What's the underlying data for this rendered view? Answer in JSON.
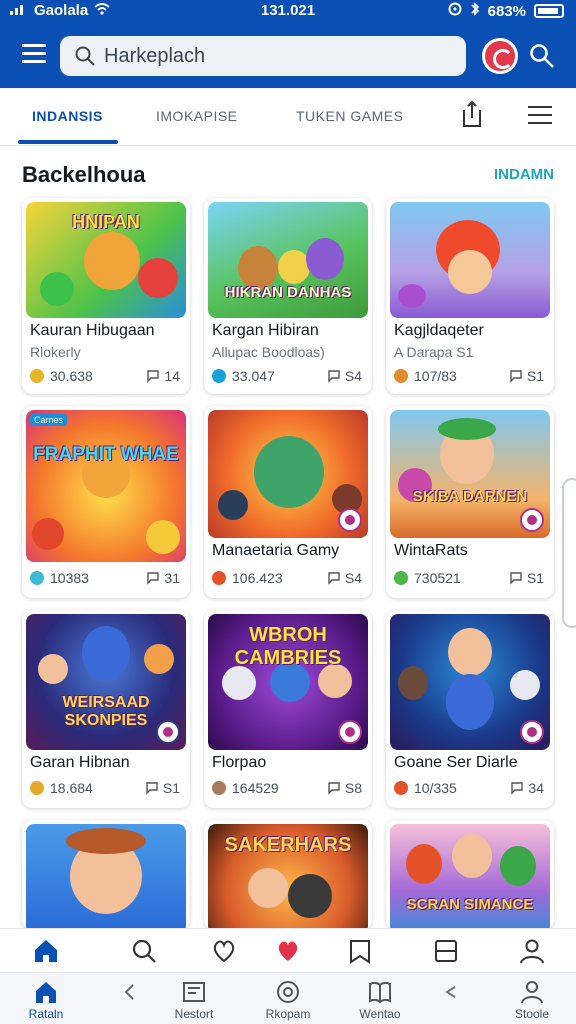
{
  "status_bar": {
    "carrier": "Gaolala",
    "time": "131.021",
    "battery": "683%"
  },
  "search": {
    "placeholder": "Harkeplach"
  },
  "tabs": [
    {
      "label": "INDANSIS",
      "active": true
    },
    {
      "label": "IMOKAPISE",
      "active": false
    },
    {
      "label": "TUKEN GAMES",
      "active": false
    }
  ],
  "section": {
    "title": "Backelhoua",
    "link": "INDAMN"
  },
  "cards": [
    {
      "art": "HNIPAN",
      "name": "Kauran Hibugaan",
      "sub": "Rlokerly",
      "count": "30.638",
      "comments": "14"
    },
    {
      "art": "HIKRAN DANHAS",
      "name": "Kargan Hibiran",
      "sub": "Allupac Boodloas)",
      "count": "33.047",
      "comments": "S4"
    },
    {
      "art": "",
      "name": "Kagjldaqeter",
      "sub": "A Darapa S1",
      "count": "107/83",
      "comments": "S1"
    },
    {
      "art": "FRAPHIT WHAE",
      "name": "",
      "sub": "",
      "count": "10383",
      "comments": "31",
      "tag": "Carnes"
    },
    {
      "art": "",
      "name": "Manaetaria Gamy",
      "sub": "",
      "count": "106.423",
      "comments": "S4"
    },
    {
      "art": "SKIBA DARNEN",
      "name": "WintaRats",
      "sub": "",
      "count": "730521",
      "comments": "S1"
    },
    {
      "art": "WEIRSAAD SKONPIES",
      "name": "Garan Hibnan",
      "sub": "",
      "count": "18.684",
      "comments": "S1"
    },
    {
      "art": "WBROH CAMBRIES",
      "name": "Florpao",
      "sub": "",
      "count": "164529",
      "comments": "S8"
    },
    {
      "art": "",
      "name": "Goane Ser Diarle",
      "sub": "",
      "count": "10/335",
      "comments": "34"
    },
    {
      "art": "",
      "name": "",
      "sub": "",
      "count": "",
      "comments": ""
    },
    {
      "art": "SAKERHARS",
      "name": "",
      "sub": "",
      "count": "",
      "comments": ""
    },
    {
      "art": "SCRAN SIMANCE",
      "name": "",
      "sub": "",
      "count": "",
      "comments": ""
    }
  ],
  "bottom_nav": [
    {
      "label": "Rataln",
      "icon": "home-icon",
      "active": true
    },
    {
      "label": "",
      "icon": "chevron-left-icon",
      "active": false
    },
    {
      "label": "Nestort",
      "icon": "news-icon",
      "active": false
    },
    {
      "label": "Rkopam",
      "icon": "circle-icon",
      "active": false
    },
    {
      "label": "Wentao",
      "icon": "book-icon",
      "active": false
    },
    {
      "label": "",
      "icon": "arrow-left-icon",
      "active": false
    },
    {
      "label": "Stoole",
      "icon": "profile-icon",
      "active": false
    }
  ],
  "colors": {
    "primary": "#0a4fb3",
    "accent": "#1fa6b8",
    "badge": "#b03087"
  }
}
